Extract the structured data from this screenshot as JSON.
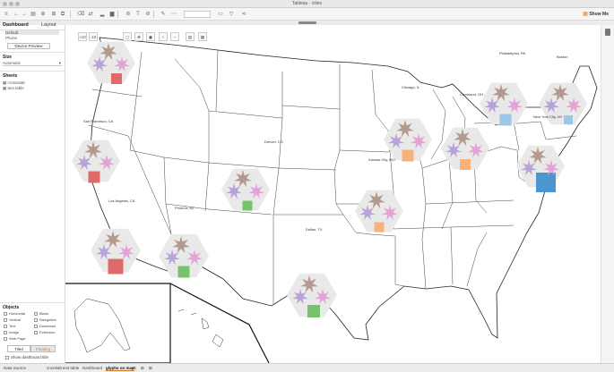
{
  "window": {
    "title": "Tableau - cities"
  },
  "toolbar": {
    "show_me": "Show Me"
  },
  "left_panel": {
    "tabs": [
      "Dashboard",
      "Layout"
    ],
    "device_items": [
      "Default",
      "Phone"
    ],
    "device_preview_button": "Device Preview",
    "size_label": "Size",
    "size_value": "Automatic",
    "sheets_label": "Sheets",
    "sheets": [
      "crossstab",
      "text table"
    ],
    "objects_label": "Objects",
    "objects": [
      "Horizontal",
      "Blank",
      "Vertical",
      "Navigation",
      "Text",
      "Download",
      "Image",
      "Extension",
      "Web Page"
    ],
    "layout_toggle": [
      "Tiled",
      "Floating"
    ],
    "show_title": "Show dashboard title"
  },
  "view_toolbar": {
    "buttons": [
      "+10",
      "-10"
    ]
  },
  "map": {
    "cities": [
      "Philadelphia, PA",
      "Boston",
      "Chicago, IL",
      "Cleveland, OH",
      "New York City, NY",
      "San Francisco, CA",
      "Denver, CO",
      "Kansas City, MO",
      "Los Angeles, CA",
      "Phoenix, AZ",
      "Dallas, TX"
    ]
  },
  "colors": {
    "glyph_brown": "#b29a8c",
    "glyph_purple": "#b8a2d9",
    "glyph_pink": "#e3a3d6",
    "hexagon": "#e9e9e9",
    "orange": "#f6b27a",
    "red": "#e06a6a",
    "green": "#77c36b",
    "blue": "#4c96d0",
    "lightblue": "#9cc8e6"
  },
  "statusbar": {
    "tabs": [
      "Data Source",
      "crosstab",
      "text table",
      "Dashboard",
      "glyphs on map"
    ]
  }
}
